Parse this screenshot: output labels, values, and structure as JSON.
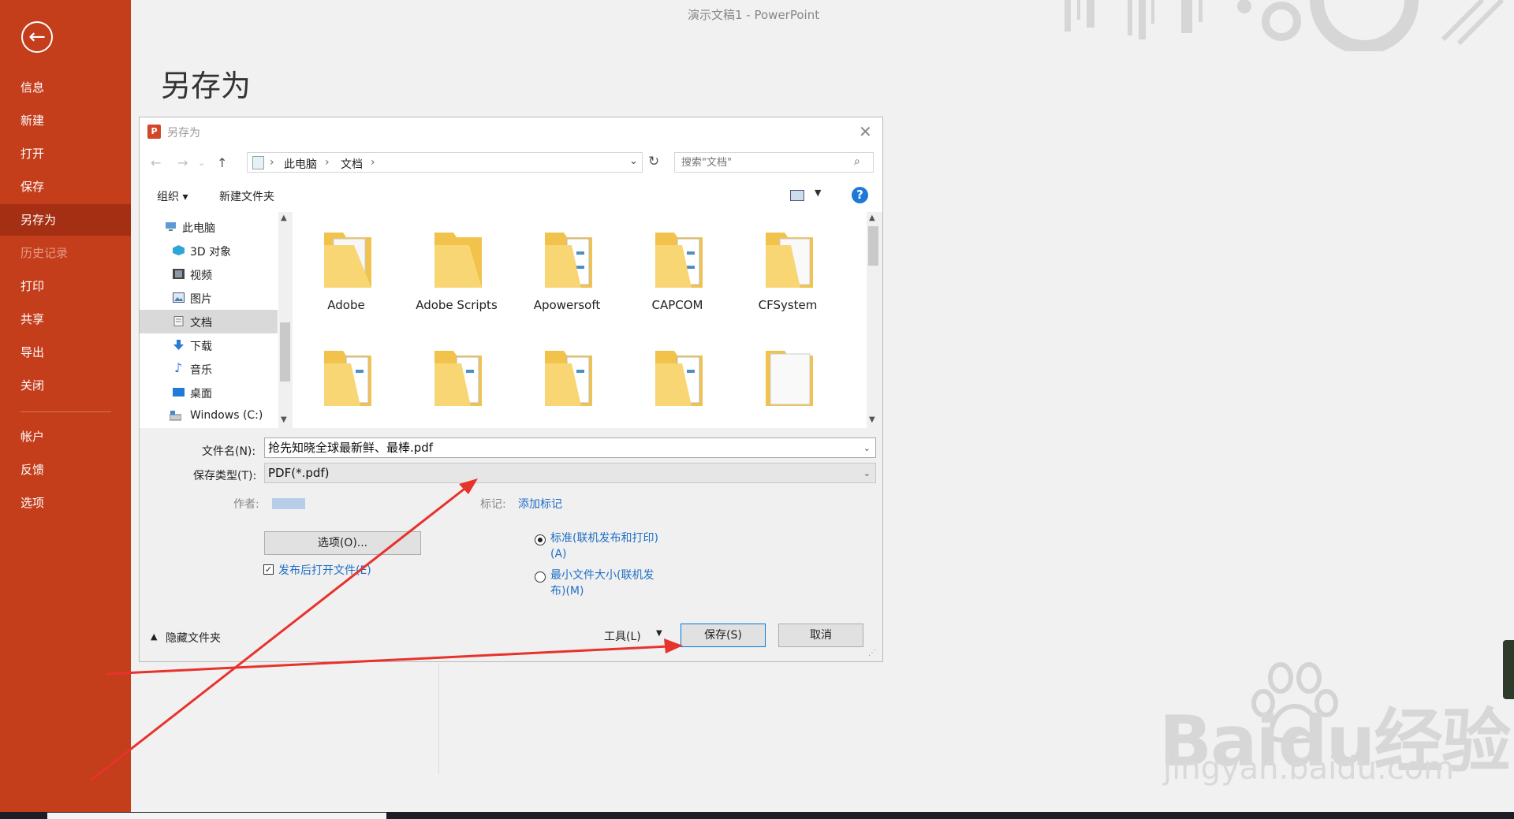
{
  "app": {
    "title": "演示文稿1  -  PowerPoint",
    "page_title": "另存为"
  },
  "sidebar": {
    "items": [
      {
        "label": "信息"
      },
      {
        "label": "新建"
      },
      {
        "label": "打开"
      },
      {
        "label": "保存"
      },
      {
        "label": "另存为",
        "active": true
      },
      {
        "label": "历史记录",
        "disabled": true
      },
      {
        "label": "打印"
      },
      {
        "label": "共享"
      },
      {
        "label": "导出"
      },
      {
        "label": "关闭"
      },
      {
        "label": "帐户"
      },
      {
        "label": "反馈"
      },
      {
        "label": "选项"
      }
    ],
    "accent": "#c43e1c"
  },
  "dialog": {
    "title": "另存为",
    "address": {
      "segments": [
        "此电脑",
        "文档"
      ],
      "search_placeholder": "搜索\"文档\""
    },
    "toolbar": {
      "organize": "组织 ▾",
      "new_folder": "新建文件夹"
    },
    "tree": [
      {
        "label": "此电脑",
        "icon": "computer-icon"
      },
      {
        "label": "3D 对象",
        "icon": "cube-icon"
      },
      {
        "label": "视频",
        "icon": "video-icon"
      },
      {
        "label": "图片",
        "icon": "picture-icon"
      },
      {
        "label": "文档",
        "icon": "document-icon",
        "selected": true
      },
      {
        "label": "下载",
        "icon": "download-icon"
      },
      {
        "label": "音乐",
        "icon": "music-icon"
      },
      {
        "label": "桌面",
        "icon": "desktop-icon"
      },
      {
        "label": "Windows (C:)",
        "icon": "drive-icon"
      }
    ],
    "files": [
      {
        "name": "Adobe"
      },
      {
        "name": "Adobe Scripts"
      },
      {
        "name": "Apowersoft"
      },
      {
        "name": "CAPCOM"
      },
      {
        "name": "CFSystem"
      },
      {
        "name": ""
      },
      {
        "name": ""
      },
      {
        "name": ""
      },
      {
        "name": ""
      },
      {
        "name": ""
      }
    ],
    "form": {
      "filename_label": "文件名(N):",
      "filename_value": "抢先知晓全球最新鲜、最棒.pdf",
      "filetype_label": "保存类型(T):",
      "filetype_value": "PDF(*.pdf)",
      "author_label": "作者:",
      "tags_label": "标记:",
      "tags_link": "添加标记",
      "options_button": "选项(O)...",
      "open_after_label": "发布后打开文件(E)",
      "open_after_checked": true,
      "radio_standard_line1": "标准(联机发布和打印)",
      "radio_standard_line2": "(A)",
      "radio_min_line1": "最小文件大小(联机发",
      "radio_min_line2": "布)(M)"
    },
    "footer": {
      "hide_folders": "隐藏文件夹",
      "tools": "工具(L)",
      "save": "保存(S)",
      "cancel": "取消"
    }
  },
  "watermark": {
    "brand": "Bai",
    "brand_tail": "du经验",
    "url": "jingyan.baidu.com"
  }
}
